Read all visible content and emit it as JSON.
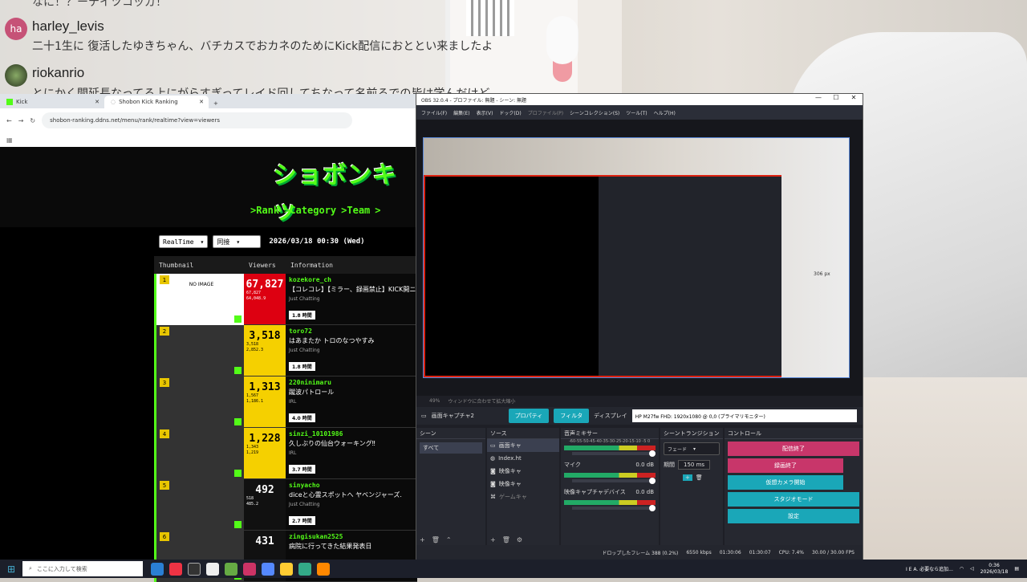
{
  "chat": {
    "top_line": "なに！？ーテイツコッガ！",
    "messages": [
      {
        "avatar": "ha",
        "user": "harley_levis",
        "text": "二十1生に 復活したゆきちゃん、バチカスでおカネのためにKick配信におととい来ましたよ"
      },
      {
        "avatar": "",
        "user": "riokanrio",
        "text": "とにかく間延長なってる上にがらすぎってレイド回してちなって名前るでの皆は学んだけど。。"
      }
    ]
  },
  "browser": {
    "tabs": [
      {
        "label": "Kick",
        "active": false
      },
      {
        "label": "Shobon Kick Ranking",
        "active": true
      }
    ],
    "new_tab": "+",
    "url": "shobon-ranking.ddns.net/menu/rank/realtime?view=viewers",
    "site": {
      "logo": "ショボンキッ",
      "nav": [
        ">Rank",
        ">Category",
        ">Team",
        ">"
      ],
      "filter_mode": "RealTime",
      "filter_group": "同接",
      "datetime": "2026/03/18 00:30 (Wed)",
      "headers": [
        "Thumbnail",
        "Viewers",
        "Information"
      ],
      "rows": [
        {
          "rank": "1",
          "viewers": "67,827",
          "peak": "67,827",
          "ave": "64,048.9",
          "channel": "kozekore_ch",
          "title": "【コレコレ】【ミラー、録画禁止】KICK開ニ",
          "tag": "Just Chatting",
          "hours": "1.8 時間",
          "color": "red"
        },
        {
          "rank": "2",
          "viewers": "3,518",
          "peak": "3,518",
          "ave": "2,852.3",
          "channel": "toro72",
          "title": "はあまたか トロのなつやすみ",
          "tag": "Just Chatting",
          "hours": "1.8 時間",
          "color": "yel"
        },
        {
          "rank": "3",
          "viewers": "1,313",
          "peak": "1,567",
          "ave": "1,186.1",
          "channel": "220ninimaru",
          "title": "蹴波パトロール",
          "tag": "IRL",
          "hours": "4.0 時間",
          "color": "yel"
        },
        {
          "rank": "4",
          "viewers": "1,228",
          "peak": "1,343",
          "ave": "1,219",
          "channel": "sinzi_10101986",
          "title": "久しぶりの仙台ウォーキング‼",
          "tag": "IRL",
          "hours": "3.7 時間",
          "color": "yel"
        },
        {
          "rank": "5",
          "viewers": "492",
          "peak": "518",
          "ave": "485.2",
          "channel": "sinyacho",
          "title": "diceと心霊スポットへ ヤベンジャーズ.",
          "tag": "Just Chatting",
          "hours": "2.7 時間",
          "color": "blk"
        },
        {
          "rank": "6",
          "viewers": "431",
          "peak": "",
          "ave": "",
          "channel": "zingisukan2525",
          "title": "病院に行ってきた結果発表日",
          "tag": "",
          "hours": "",
          "color": "blk"
        }
      ],
      "no_image": "NO IMAGE"
    }
  },
  "obs": {
    "title": "OBS 32.0.4 - プロファイル: 無題 - シーン: 無題",
    "menu": [
      "ファイル(F)",
      "編集(E)",
      "表示(V)",
      "ドック(D)",
      "プロファイル(P)",
      "シーンコレクション(S)",
      "ツール(T)",
      "ヘルプ(H)"
    ],
    "size_label": "306 px",
    "zoom": "49%",
    "zoom_hint": "ウィンドウに合わせて拡大縮小",
    "source_name": "画面キャプチャ2",
    "props_btn": "プロパティ",
    "filter_btn": "フィルタ",
    "display_label": "ディスプレイ",
    "display_value": "HP M27fw FHD: 1920x1080 @ 0,0 (プライマリモニター)",
    "docks": {
      "scenes": {
        "title": "シーン",
        "items": [
          "すべて"
        ]
      },
      "sources": {
        "title": "ソース",
        "items": [
          "画面キャ",
          "Index.ht",
          "映像キャ",
          "映像キャ",
          "ゲームキャ"
        ]
      },
      "mixer": {
        "title": "音声ミキサー",
        "scale": "-60-55-50-45-40-35-30-25-20-15-10 -5 0",
        "tracks": [
          {
            "name": "マイク",
            "db": "0.0 dB"
          },
          {
            "name": "映像キャプチャデバイス",
            "db": "0.0 dB"
          }
        ]
      },
      "transitions": {
        "title": "シーントランジション",
        "type": "フェード",
        "duration_label": "期間",
        "duration": "150 ms"
      },
      "controls": {
        "title": "コントロール",
        "buttons": [
          "配信終了",
          "録画終了",
          "仮想カメラ開始",
          "スタジオモード",
          "設定"
        ]
      }
    },
    "status": {
      "dropped": "ドロップしたフレーム 388 (0.2%)",
      "kbps": "6550 kbps",
      "stream_time": "01:30:06",
      "rec_time": "01:30:07",
      "cpu": "CPU: 7.4%",
      "fps": "30.00 / 30.00 FPS"
    }
  },
  "taskbar": {
    "search": "ここに入力して検索",
    "tray_text": "I E A. 必要なら追加...",
    "time": "0:36",
    "date": "2026/03/18"
  }
}
